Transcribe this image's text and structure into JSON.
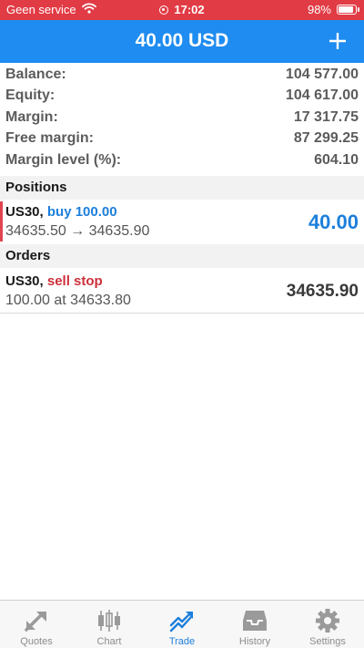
{
  "status_bar": {
    "carrier": "Geen service",
    "time": "17:02",
    "battery": "98%",
    "battery_level": 0.98
  },
  "header": {
    "title": "40.00 USD"
  },
  "account": {
    "rows": [
      {
        "label": "Balance:",
        "value": "104 577.00"
      },
      {
        "label": "Equity:",
        "value": "104 617.00"
      },
      {
        "label": "Margin:",
        "value": "17 317.75"
      },
      {
        "label": "Free margin:",
        "value": "87 299.25"
      },
      {
        "label": "Margin level (%):",
        "value": "604.10"
      }
    ]
  },
  "positions": {
    "header": "Positions",
    "items": [
      {
        "symbol": "US30,",
        "action": "buy 100.00",
        "prices": "34635.50 → 34635.90",
        "profit": "40.00"
      }
    ]
  },
  "orders": {
    "header": "Orders",
    "items": [
      {
        "symbol": "US30,",
        "action": "sell stop",
        "details": "100.00 at 34633.80",
        "price": "34635.90"
      }
    ]
  },
  "tabs": [
    {
      "label": "Quotes",
      "icon": "quotes-icon",
      "active": false
    },
    {
      "label": "Chart",
      "icon": "chart-icon",
      "active": false
    },
    {
      "label": "Trade",
      "icon": "trade-icon",
      "active": true
    },
    {
      "label": "History",
      "icon": "history-icon",
      "active": false
    },
    {
      "label": "Settings",
      "icon": "settings-icon",
      "active": false
    }
  ],
  "colors": {
    "status_bar": "#e13b45",
    "header": "#1e8cf0",
    "accent": "#1c7fdc",
    "sell": "#cc2f3a"
  }
}
